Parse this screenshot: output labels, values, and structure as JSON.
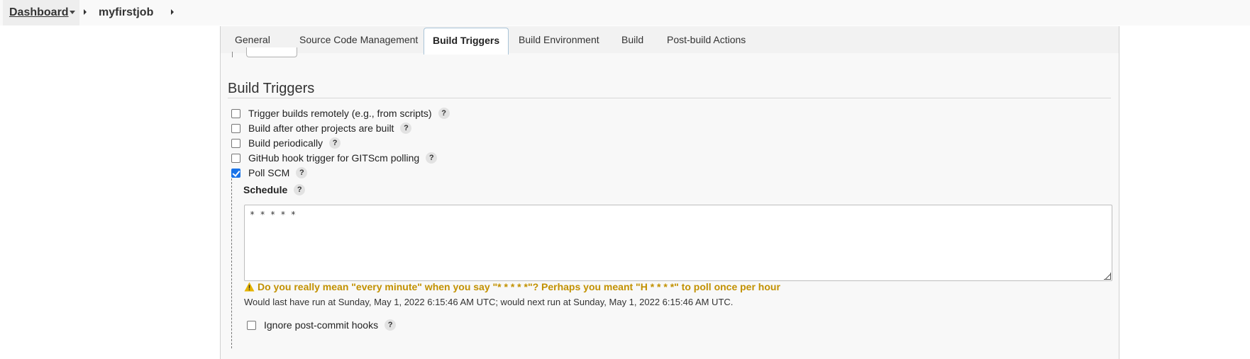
{
  "breadcrumb": {
    "items": [
      {
        "label": "Dashboard"
      },
      {
        "label": "myfirstjob"
      }
    ]
  },
  "tabs": [
    {
      "label": "General"
    },
    {
      "label": "Source Code Management"
    },
    {
      "label": "Build Triggers",
      "active": true
    },
    {
      "label": "Build Environment"
    },
    {
      "label": "Build"
    },
    {
      "label": "Post-build Actions"
    }
  ],
  "section": {
    "title": "Build Triggers"
  },
  "triggers": [
    {
      "label": "Trigger builds remotely (e.g., from scripts)",
      "checked": false
    },
    {
      "label": "Build after other projects are built",
      "checked": false
    },
    {
      "label": "Build periodically",
      "checked": false
    },
    {
      "label": "GitHub hook trigger for GITScm polling",
      "checked": false
    },
    {
      "label": "Poll SCM",
      "checked": true
    }
  ],
  "poll_scm": {
    "schedule_label": "Schedule",
    "schedule_value": "* * * * *",
    "warning": "Do you really mean \"every minute\" when you say \"* * * * *\"? Perhaps you meant \"H * * * *\" to poll once per hour",
    "run_info": "Would last have run at Sunday, May 1, 2022 6:15:46 AM UTC; would next run at Sunday, May 1, 2022 6:15:46 AM UTC.",
    "ignore_hooks_label": "Ignore post-commit hooks",
    "ignore_hooks_checked": false
  },
  "help_icon_glyph": "?",
  "icons": {
    "breadcrumb_dropdown": "chevron-down-icon",
    "breadcrumb_separator": "chevron-right-icon",
    "help": "help-icon",
    "warning": "warning-icon"
  },
  "colors": {
    "checkbox_checked": "#1a73e8",
    "warning_text": "#c29100",
    "warning_icon": "#e6b400"
  }
}
